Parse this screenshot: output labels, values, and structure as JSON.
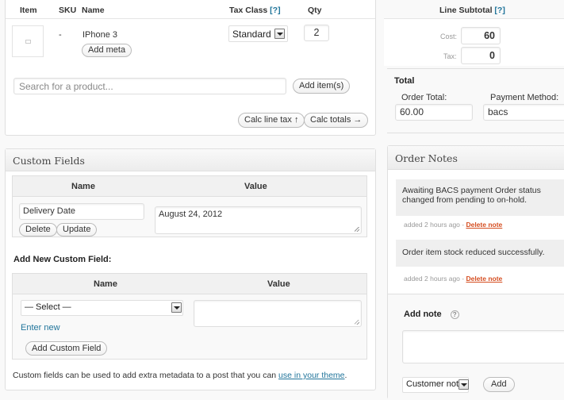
{
  "items": {
    "headers": {
      "item": "Item",
      "sku": "SKU",
      "name": "Name",
      "tax_class": "Tax Class",
      "tax_help": "[?]",
      "qty": "Qty",
      "line_subtotal": "Line Subtotal",
      "subtotal_help": "[?]"
    },
    "row": {
      "sku": "-",
      "name": "IPhone 3",
      "add_meta": "Add meta",
      "tax_class": "Standard",
      "qty": "2",
      "cost_label": "Cost:",
      "cost": "60",
      "tax_label": "Tax:",
      "tax": "0"
    },
    "search_placeholder": "Search for a product...",
    "add_items": "Add item(s)",
    "calc_line_tax": "Calc line tax ↑",
    "calc_totals": "Calc totals →"
  },
  "totals": {
    "title": "Total",
    "order_total_label": "Order Total:",
    "order_total": "60.00",
    "payment_method_label": "Payment Method:",
    "payment_method": "bacs"
  },
  "custom_fields": {
    "title": "Custom Fields",
    "name_header": "Name",
    "value_header": "Value",
    "existing": {
      "name": "Delivery Date",
      "value": "August 24, 2012",
      "delete": "Delete",
      "update": "Update"
    },
    "add_new_title": "Add New Custom Field:",
    "select_value": "— Select —",
    "enter_new": "Enter new",
    "add_button": "Add Custom Field",
    "footer_text": "Custom fields can be used to add extra metadata to a post that you can ",
    "footer_link": "use in your theme",
    "footer_end": "."
  },
  "order_notes": {
    "title": "Order Notes",
    "notes": [
      {
        "text": "Awaiting BACS payment Order status changed from pending to on-hold.",
        "meta": "added 2 hours ago - ",
        "delete": "Delete note"
      },
      {
        "text": "Order item stock reduced successfully.",
        "meta": "added 2 hours ago - ",
        "delete": "Delete note"
      }
    ],
    "add_note_label": "Add note",
    "help_icon": "?",
    "note_type": "Customer note",
    "add_button": "Add"
  }
}
